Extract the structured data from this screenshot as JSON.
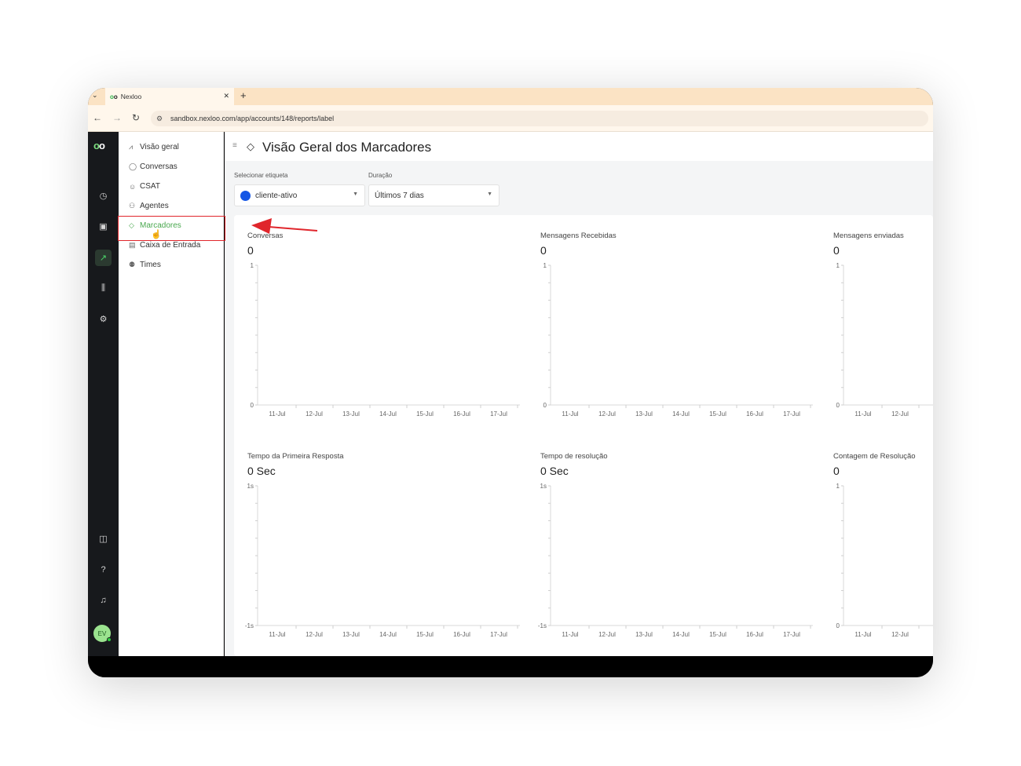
{
  "browser": {
    "tab_title": "Nexloo",
    "url": "sandbox.nexloo.com/app/accounts/148/reports/label"
  },
  "icons": {
    "chevron": "chevron-down-icon",
    "back": "arrow-left-icon",
    "forward": "arrow-right-icon",
    "reload": "reload-icon",
    "tag": "tag-icon"
  },
  "sidebar": {
    "items": [
      {
        "label": "Visão geral",
        "icon": "chart-icon"
      },
      {
        "label": "Conversas",
        "icon": "chat-icon"
      },
      {
        "label": "CSAT",
        "icon": "smile-icon"
      },
      {
        "label": "Agentes",
        "icon": "users-icon"
      },
      {
        "label": "Marcadores",
        "icon": "tag-icon",
        "active": true
      },
      {
        "label": "Caixa de Entrada",
        "icon": "inbox-icon"
      },
      {
        "label": "Times",
        "icon": "team-icon"
      }
    ]
  },
  "avatar": {
    "initials": "EV"
  },
  "page": {
    "title": "Visão Geral dos Marcadores",
    "filters": {
      "label_label": "Selecionar etiqueta",
      "label_value": "cliente-ativo",
      "label_color": "#1456e5",
      "duration_label": "Duração",
      "duration_value": "Últimos 7 dias"
    }
  },
  "metrics": [
    {
      "title": "Conversas",
      "value": "0"
    },
    {
      "title": "Mensagens Recebidas",
      "value": "0"
    },
    {
      "title": "Mensagens enviadas",
      "value": "0"
    },
    {
      "title": "Tempo da Primeira Resposta",
      "value": "0 Sec"
    },
    {
      "title": "Tempo de resolução",
      "value": "0 Sec"
    },
    {
      "title": "Contagem de Resolução",
      "value": "0"
    }
  ],
  "chart_data": [
    {
      "type": "bar",
      "title": "Conversas",
      "categories": [
        "11-Jul",
        "12-Jul",
        "13-Jul",
        "14-Jul",
        "15-Jul",
        "16-Jul",
        "17-Jul"
      ],
      "values": [
        0,
        0,
        0,
        0,
        0,
        0,
        0
      ],
      "ylim": [
        0,
        1
      ],
      "yticks": [
        "0",
        "1"
      ]
    },
    {
      "type": "bar",
      "title": "Mensagens Recebidas",
      "categories": [
        "11-Jul",
        "12-Jul",
        "13-Jul",
        "14-Jul",
        "15-Jul",
        "16-Jul",
        "17-Jul"
      ],
      "values": [
        0,
        0,
        0,
        0,
        0,
        0,
        0
      ],
      "ylim": [
        0,
        1
      ],
      "yticks": [
        "0",
        "1"
      ]
    },
    {
      "type": "bar",
      "title": "Mensagens enviadas",
      "categories": [
        "11-Jul",
        "12-Jul"
      ],
      "values": [
        0,
        0
      ],
      "ylim": [
        0,
        1
      ],
      "yticks": [
        "0",
        "1"
      ]
    },
    {
      "type": "bar",
      "title": "Tempo da Primeira Resposta",
      "categories": [
        "11-Jul",
        "12-Jul",
        "13-Jul",
        "14-Jul",
        "15-Jul",
        "16-Jul",
        "17-Jul"
      ],
      "values": [
        0,
        0,
        0,
        0,
        0,
        0,
        0
      ],
      "ylim": [
        -1,
        1
      ],
      "yticks": [
        "-1s",
        "1s"
      ]
    },
    {
      "type": "bar",
      "title": "Tempo de resolução",
      "categories": [
        "11-Jul",
        "12-Jul",
        "13-Jul",
        "14-Jul",
        "15-Jul",
        "16-Jul",
        "17-Jul"
      ],
      "values": [
        0,
        0,
        0,
        0,
        0,
        0,
        0
      ],
      "ylim": [
        -1,
        1
      ],
      "yticks": [
        "-1s",
        "1s"
      ]
    },
    {
      "type": "bar",
      "title": "Contagem de Resolução",
      "categories": [
        "11-Jul",
        "12-Jul"
      ],
      "values": [
        0,
        0
      ],
      "ylim": [
        0,
        1
      ],
      "yticks": [
        "0",
        "1"
      ]
    }
  ]
}
